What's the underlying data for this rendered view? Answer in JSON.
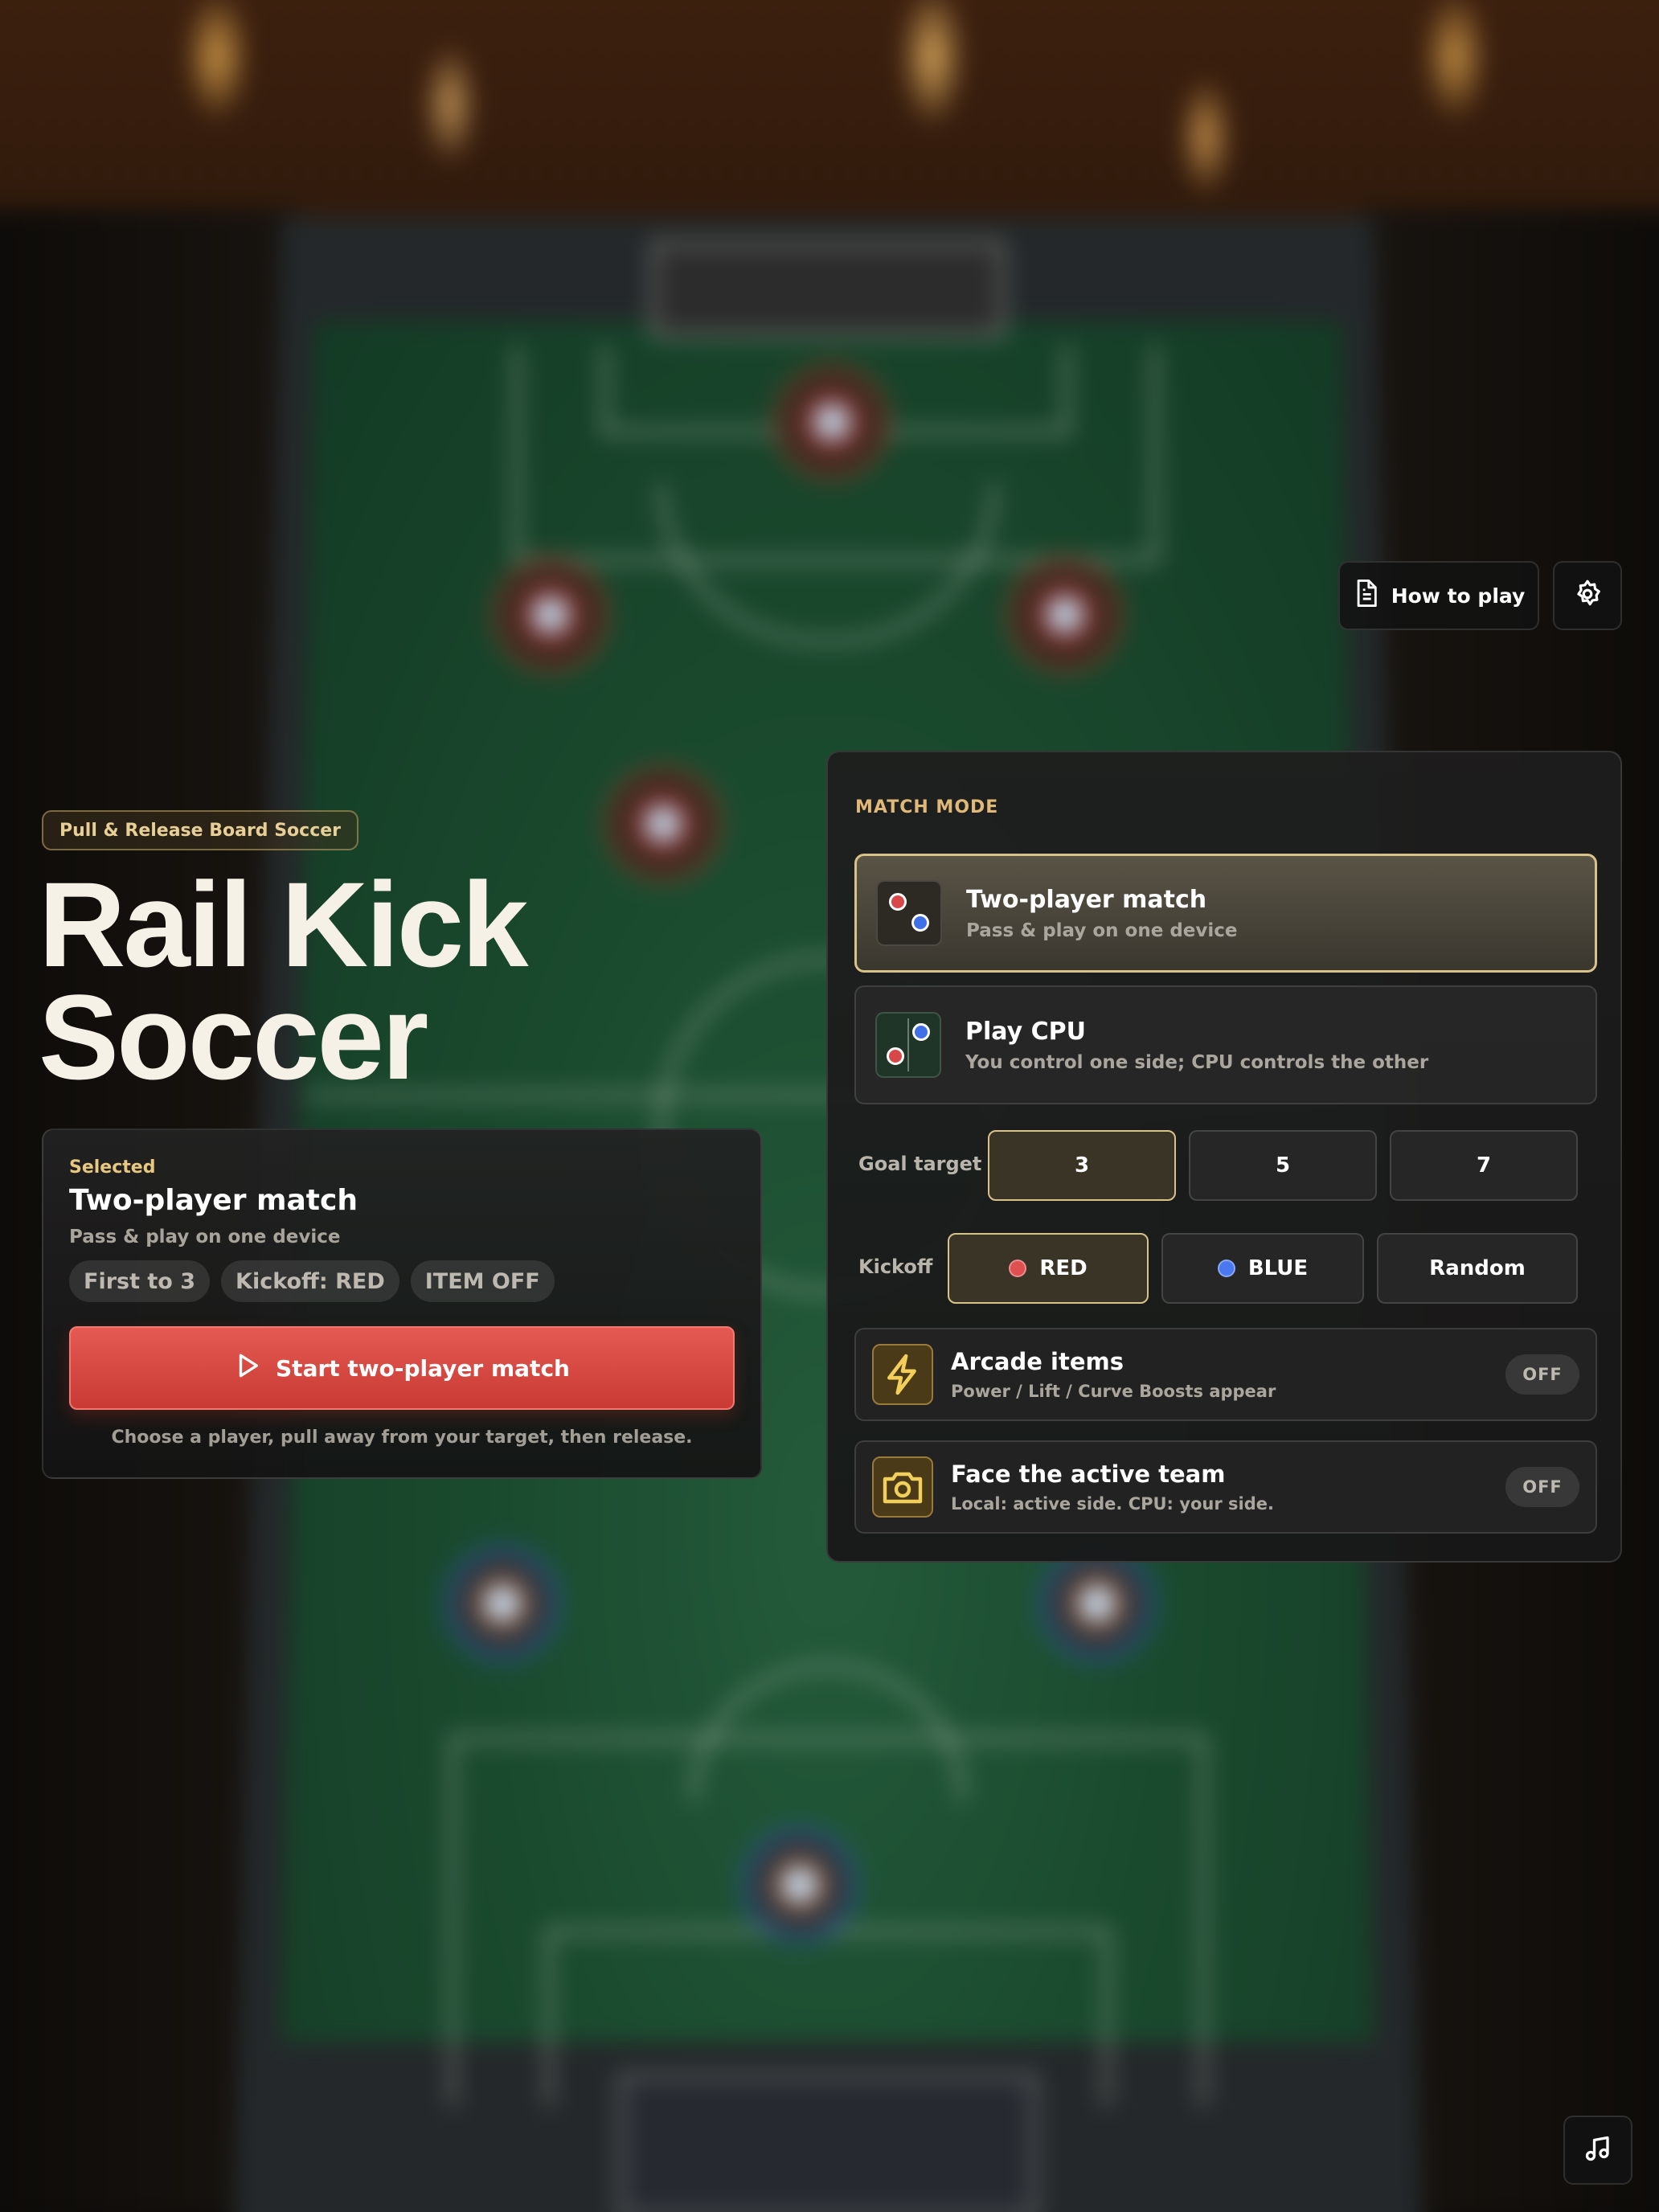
{
  "colors": {
    "accent_gold": "#d8c28a",
    "start_button": "#d9473f",
    "red_team": "#d84848",
    "blue_team": "#3f70e8"
  },
  "header": {
    "how_to_play_label": "How to play",
    "how_to_play_icon": "document-icon",
    "settings_icon": "gear-icon"
  },
  "hero": {
    "tag": "Pull & Release Board Soccer",
    "title_line1": "Rail Kick",
    "title_line2": "Soccer"
  },
  "selected": {
    "label": "Selected",
    "title": "Two-player match",
    "subtitle": "Pass & play on one device",
    "chips": [
      "First to 3",
      "Kickoff: RED",
      "ITEM OFF"
    ],
    "start_label": "Start two-player match",
    "start_icon": "play-icon",
    "hint": "Choose a player, pull away from your target, then release."
  },
  "panel": {
    "heading": "MATCH MODE",
    "modes": [
      {
        "title": "Two-player match",
        "subtitle": "Pass & play on one device",
        "selected": true
      },
      {
        "title": "Play CPU",
        "subtitle": "You control one side; CPU controls the other",
        "selected": false
      }
    ],
    "goal_target": {
      "label": "Goal target",
      "options": [
        "3",
        "5",
        "7"
      ],
      "selected": "3"
    },
    "kickoff": {
      "label": "Kickoff",
      "options": [
        "RED",
        "BLUE",
        "Random"
      ],
      "selected": "RED"
    },
    "toggles": [
      {
        "title": "Arcade items",
        "subtitle": "Power / Lift / Curve Boosts appear",
        "state": "OFF",
        "icon": "lightning-icon"
      },
      {
        "title": "Face the active team",
        "subtitle": "Local: active side. CPU: your side.",
        "state": "OFF",
        "icon": "camera-icon"
      }
    ]
  },
  "footer": {
    "music_icon": "music-note-icon"
  }
}
